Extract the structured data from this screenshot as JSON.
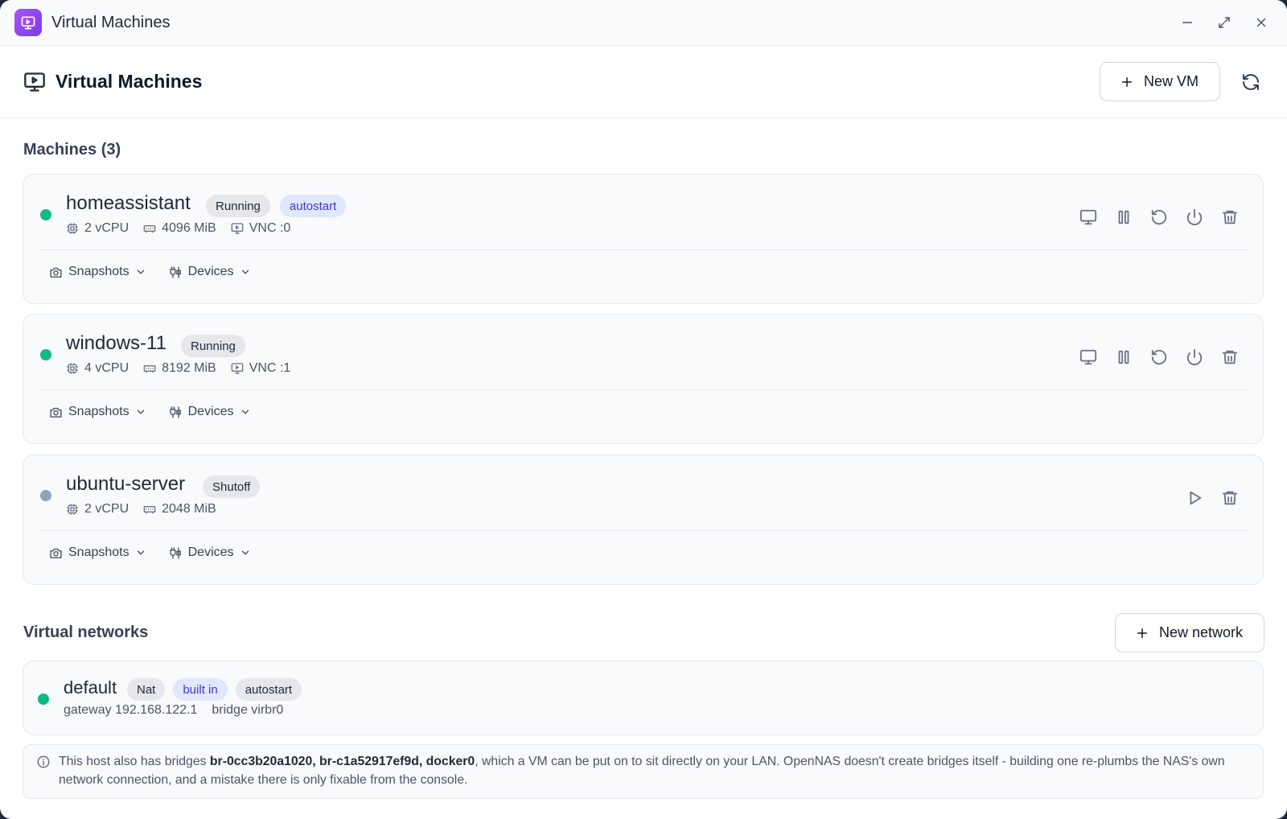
{
  "window": {
    "title": "Virtual Machines"
  },
  "header": {
    "title": "Virtual Machines",
    "new_vm_label": "New VM"
  },
  "machines": {
    "title": "Machines (3)",
    "items": [
      {
        "name": "homeassistant",
        "status": "Running",
        "autostart": "autostart",
        "cpu": "2 vCPU",
        "memory": "4096 MiB",
        "vnc": "VNC :0",
        "snapshots_label": "Snapshots",
        "devices_label": "Devices",
        "status_color": "#10b981"
      },
      {
        "name": "windows-11",
        "status": "Running",
        "cpu": "4 vCPU",
        "memory": "8192 MiB",
        "vnc": "VNC :1",
        "snapshots_label": "Snapshots",
        "devices_label": "Devices",
        "status_color": "#10b981"
      },
      {
        "name": "ubuntu-server",
        "status": "Shutoff",
        "cpu": "2 vCPU",
        "memory": "2048 MiB",
        "snapshots_label": "Snapshots",
        "devices_label": "Devices",
        "status_color": "#94a3b8"
      }
    ]
  },
  "networks": {
    "title": "Virtual networks",
    "new_network_label": "New network",
    "items": [
      {
        "name": "default",
        "badge_type": "Nat",
        "badge_builtin": "built in",
        "badge_autostart": "autostart",
        "gateway": "gateway 192.168.122.1",
        "bridge": "bridge virbr0",
        "status_color": "#10b981"
      }
    ]
  },
  "notice": {
    "prefix": "This host also has bridges ",
    "bridges": "br-0cc3b20a1020, br-c1a52917ef9d, docker0",
    "suffix": ", which a VM can be put on to sit directly on your LAN. OpenNAS doesn't create bridges itself - building one re-plumbs the NAS's own network connection, and a mistake there is only fixable from the console."
  },
  "colors": {
    "accent": "#8b5cf6",
    "running": "#10b981",
    "shutoff": "#94a3b8",
    "badge_purple_text": "#4338ca"
  },
  "icons": [
    "monitor-play-icon",
    "minimize-icon",
    "maximize-icon",
    "close-icon",
    "plus-icon",
    "refresh-icon",
    "cpu-icon",
    "memory-icon",
    "vnc-icon",
    "display-icon",
    "pause-icon",
    "restart-icon",
    "power-icon",
    "trash-icon",
    "play-icon",
    "camera-icon",
    "devices-icon",
    "chevron-down-icon",
    "info-icon"
  ]
}
